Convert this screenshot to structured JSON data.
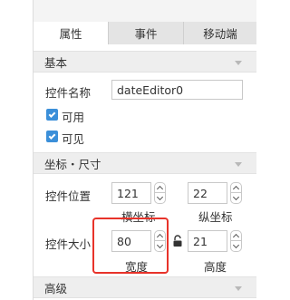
{
  "tabs": [
    {
      "label": "属性",
      "active": true
    },
    {
      "label": "事件",
      "active": false
    },
    {
      "label": "移动端",
      "active": false
    }
  ],
  "sections": {
    "basic": {
      "title": "基本"
    },
    "position_size": {
      "title": "坐标・尺寸"
    },
    "advanced": {
      "title": "高级"
    }
  },
  "basic": {
    "name_label": "控件名称",
    "name_value": "dateEditor0",
    "enabled_label": "可用",
    "enabled_checked": true,
    "visible_label": "可见",
    "visible_checked": true
  },
  "position": {
    "label": "控件位置",
    "x_value": "121",
    "x_label": "横坐标",
    "y_value": "22",
    "y_label": "纵坐标"
  },
  "size": {
    "label": "控件大小",
    "width_value": "80",
    "width_label": "宽度",
    "height_value": "21",
    "height_label": "高度"
  },
  "colors": {
    "checkbox": "#3b8fd9",
    "highlight": "#e8332a"
  }
}
